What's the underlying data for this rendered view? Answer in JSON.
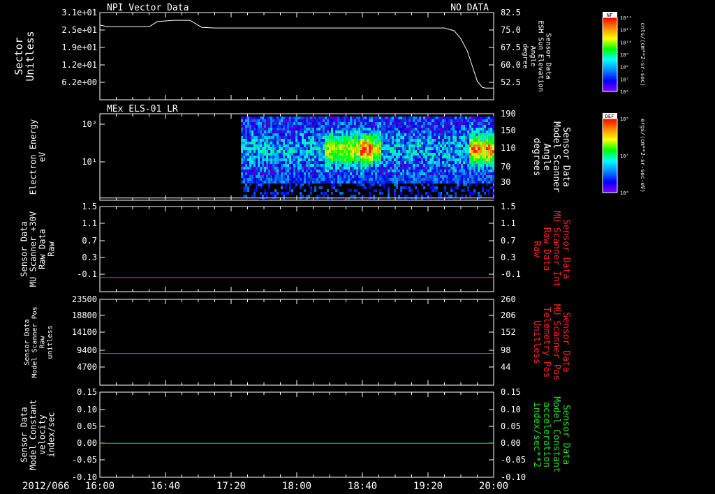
{
  "date_label": "2012/066",
  "time_axis": {
    "ticks": [
      "16:00",
      "16:40",
      "17:20",
      "18:00",
      "18:40",
      "19:20",
      "20:00"
    ]
  },
  "colorbars": [
    {
      "title": "NF",
      "unit": "cnts/(cm**2-sr-sec)",
      "tick_labels": [
        "10¹²",
        "10¹¹",
        "10¹⁰",
        "10⁹",
        "10⁸",
        "10⁷",
        "10⁶"
      ]
    },
    {
      "title": "DEF",
      "unit": "ergs/(cm**2-sr-sec-eV)",
      "tick_labels": [
        "10⁸",
        "10⁷",
        "10⁶"
      ]
    }
  ],
  "colors": {
    "white": "#ffffff",
    "red": "#ff2020",
    "green": "#20e020"
  },
  "chart_data": [
    {
      "type": "line",
      "title": "NPI Vector Data",
      "status": "NO DATA",
      "left_axis": {
        "label_lines": [
          "Sector",
          "Unitless"
        ],
        "tick_labels": [
          "3.1e+01",
          "2.5e+01",
          "1.9e+01",
          "1.2e+01",
          "6.2e+00"
        ],
        "ylim": [
          0,
          31
        ]
      },
      "right_axis": {
        "label_lines": [
          "Sensor Data",
          "ESH Sun Elevation",
          "Angle",
          "degree"
        ],
        "tick_labels": [
          "82.5",
          "75.0",
          "67.5",
          "60.0",
          "52.5"
        ],
        "ylim": [
          47.5,
          82.5
        ]
      },
      "series": [
        {
          "axis": "right",
          "color": "#ffffff",
          "x": [
            "16:00",
            "16:05",
            "16:30",
            "16:35",
            "16:45",
            "16:55",
            "17:02",
            "17:10",
            "19:05",
            "19:30",
            "19:36",
            "19:40",
            "19:44",
            "19:48",
            "19:50",
            "19:53",
            "19:55",
            "20:00"
          ],
          "y": [
            77.5,
            76.8,
            76.8,
            78.9,
            79.4,
            79.4,
            76.6,
            76.3,
            76.3,
            76.3,
            75.2,
            72,
            67,
            59,
            55,
            52.5,
            52.2,
            52.2
          ]
        }
      ]
    },
    {
      "type": "heatmap",
      "title": "MEx ELS-01 LR",
      "left_axis": {
        "label_lines": [
          "Electron Energy",
          "eV"
        ],
        "tick_labels": [
          "10¹",
          "10²"
        ],
        "scale": "log",
        "ylim": [
          1.6,
          180
        ]
      },
      "right_axis": {
        "label_lines": [
          "Sensor Data",
          "Model Scanner",
          "Angle",
          "degrees"
        ],
        "tick_labels": [
          "190",
          "150",
          "110",
          "70",
          "30"
        ],
        "ylim": [
          0,
          190
        ]
      },
      "series": [
        {
          "axis": "right",
          "color": "#ffffff",
          "x": [
            "16:00",
            "20:00"
          ],
          "y": [
            5,
            5
          ]
        }
      ],
      "data_span": [
        "17:26",
        "20:00"
      ]
    },
    {
      "type": "line",
      "left_axis": {
        "label_lines": [
          "Sensor Data",
          "MU Scanner +30V",
          "Raw Data",
          "Raw"
        ],
        "tick_labels": [
          "1.5",
          "1.1",
          "0.7",
          "0.3",
          "-0.1"
        ],
        "ylim": [
          -0.3,
          1.5
        ]
      },
      "right_axis": {
        "label_lines": [
          "Sensor Data",
          "MU Scanner Int",
          "Raw Data",
          "Raw"
        ],
        "label_color": "#ff2020",
        "tick_labels": [
          "1.5",
          "1.1",
          "0.7",
          "0.3",
          "-0.1"
        ],
        "ylim": [
          -0.3,
          1.5
        ]
      },
      "series": [
        {
          "axis": "left",
          "color": "#ff2020",
          "x": [
            "16:00",
            "20:00"
          ],
          "y": [
            0.0,
            0.0
          ]
        }
      ]
    },
    {
      "type": "line",
      "left_axis": {
        "label_lines": [
          "Sensor Data",
          "Model Scanner Pos",
          "Raw",
          "unitless"
        ],
        "tick_labels": [
          "23500",
          "18800",
          "14100",
          "9400",
          "4700"
        ],
        "ylim": [
          0,
          23500
        ]
      },
      "right_axis": {
        "label_lines": [
          "Sensor Data",
          "MU Scanner Pos",
          "Telemetry Pos",
          "Unitless"
        ],
        "label_color": "#ff2020",
        "tick_labels": [
          "260",
          "206",
          "152",
          "98",
          "44"
        ],
        "ylim": [
          0,
          260
        ]
      },
      "series": [
        {
          "axis": "left",
          "color": "#ff2020",
          "x": [
            "16:00",
            "20:00"
          ],
          "y": [
            8700,
            8700
          ]
        }
      ]
    },
    {
      "type": "line",
      "left_axis": {
        "label_lines": [
          "Sensor Data",
          "Model Constant",
          "velocity",
          "index/sec"
        ],
        "tick_labels": [
          "0.15",
          "0.10",
          "0.05",
          "0.00",
          "-0.05",
          "-0.10"
        ],
        "ylim": [
          -0.1,
          0.15
        ]
      },
      "right_axis": {
        "label_lines": [
          "Sensor Data",
          "Model Constant",
          "acceleration",
          "index/sec**2"
        ],
        "label_color": "#20e020",
        "tick_labels": [
          "0.15",
          "0.10",
          "0.05",
          "0.00",
          "-0.05",
          "-0.10"
        ],
        "ylim": [
          -0.1,
          0.15
        ]
      },
      "series": [
        {
          "axis": "left",
          "color": "#20e020",
          "x": [
            "16:00",
            "20:00"
          ],
          "y": [
            0.0,
            0.0
          ]
        }
      ]
    }
  ]
}
